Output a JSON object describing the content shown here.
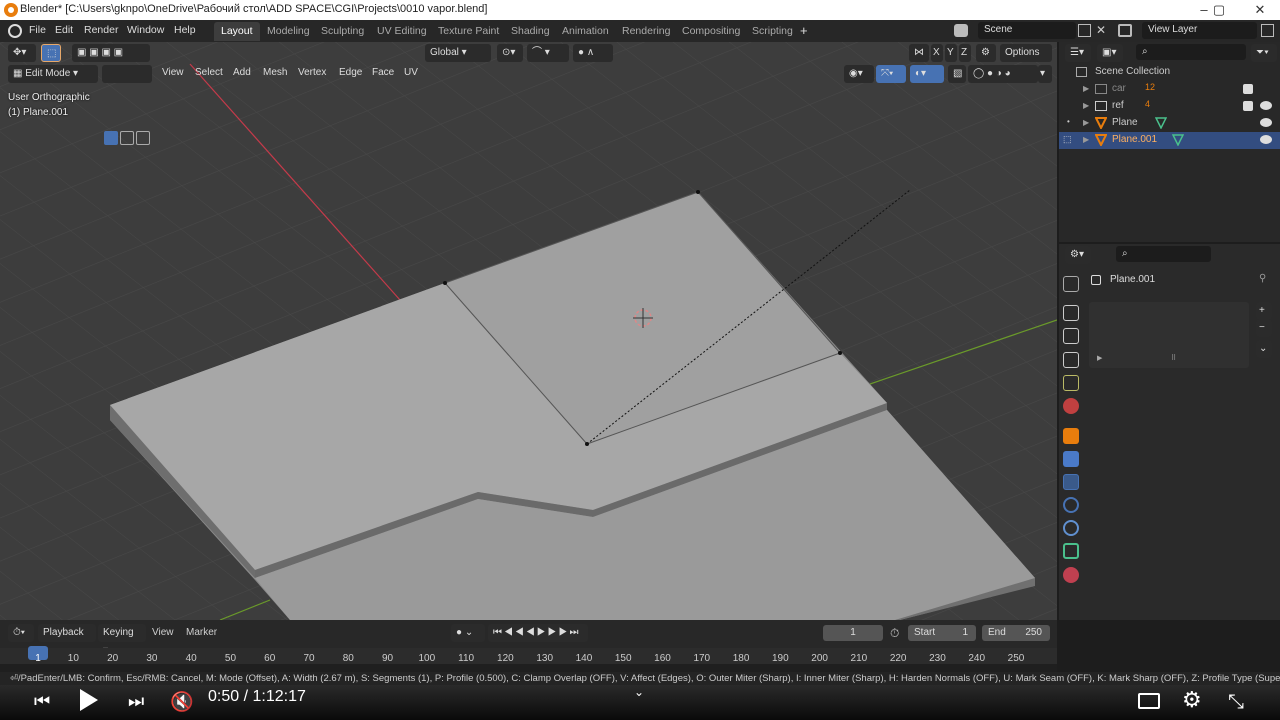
{
  "window": {
    "title": "Blender* [C:\\Users\\gknpo\\OneDrive\\Рабочий стол\\ADD SPACE\\CGI\\Projects\\0010 vapor.blend]"
  },
  "menu": {
    "items": [
      "File",
      "Edit",
      "Render",
      "Window",
      "Help"
    ]
  },
  "workspaces": {
    "tabs": [
      "Layout",
      "Modeling",
      "Sculpting",
      "UV Editing",
      "Texture Paint",
      "Shading",
      "Animation",
      "Rendering",
      "Compositing",
      "Scripting"
    ],
    "active": "Layout",
    "add": "+"
  },
  "scene": {
    "name": "Scene",
    "view_layer": "View Layer"
  },
  "viewport": {
    "orientation": "Global",
    "options": "Options",
    "mode": "Edit Mode",
    "menus": [
      "View",
      "Select",
      "Add",
      "Mesh",
      "Vertex",
      "Edge",
      "Face",
      "UV"
    ],
    "view_name": "User Orthographic",
    "object_info": "(1) Plane.001",
    "axes": [
      "X",
      "Y",
      "Z"
    ]
  },
  "outliner": {
    "root": "Scene Collection",
    "rows": [
      {
        "label": "car",
        "badge": "12",
        "dim": true
      },
      {
        "label": "ref",
        "badge": "4",
        "dim": false
      },
      {
        "label": "Plane",
        "badge": "",
        "dim": false
      },
      {
        "label": "Plane.001",
        "badge": "",
        "dim": false,
        "selected": true
      }
    ]
  },
  "properties": {
    "object_name": "Plane.001",
    "plus": "+",
    "minus": "−"
  },
  "timeline": {
    "menus": [
      "Playback",
      "Keying",
      "View",
      "Marker"
    ],
    "current_frame": "1",
    "start_label": "Start",
    "start": "1",
    "end_label": "End",
    "end": "250",
    "ticks": [
      "1",
      "10",
      "20",
      "30",
      "40",
      "50",
      "60",
      "70",
      "80",
      "90",
      "100",
      "110",
      "120",
      "130",
      "140",
      "150",
      "160",
      "170",
      "180",
      "190",
      "200",
      "210",
      "220",
      "230",
      "240",
      "250"
    ]
  },
  "status": {
    "text": "⏎/PadEnter/LMB: Confirm, Esc/RMB: Cancel, M: Mode (Offset), A: Width (2.67 m), S: Segments (1), P: Profile (0.500), C: Clamp Overlap (OFF), V: Affect (Edges), O: Outer Miter (Sharp), I: Inner Miter (Sharp), H: Harden Normals (OFF), U: Mark Seam (OFF), K: Mark Sharp (OFF), Z: Profile Type (Superellip"
  },
  "video": {
    "time": "0:50 / 1:12:17"
  },
  "colors": {
    "accent_blue": "#4772b3",
    "selected_row": "#334d80",
    "orange": "#e87d0d"
  }
}
